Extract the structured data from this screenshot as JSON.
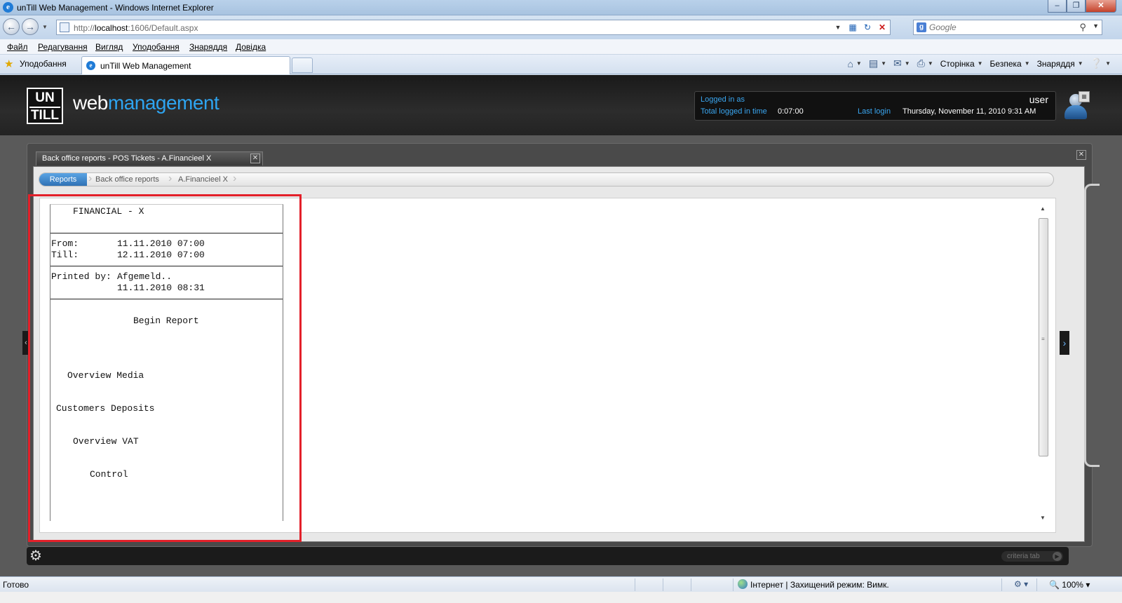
{
  "browser": {
    "window_title": "unTill Web Management - Windows Internet Explorer",
    "url_prefix": "http://",
    "url_host": "localhost",
    "url_rest": ":1606/Default.aspx",
    "search_placeholder": "Google",
    "menu": [
      "Файл",
      "Редагування",
      "Вигляд",
      "Уподобання",
      "Знаряддя",
      "Довідка"
    ],
    "favorites_label": "Уподобання",
    "tab_title": "unTill Web Management",
    "commands": {
      "page": "Сторінка",
      "safety": "Безпека",
      "tools": "Знаряддя"
    },
    "status": {
      "ready": "Готово",
      "zone": "Інтернет | Захищений режим: Вимк.",
      "zoom": "100%"
    }
  },
  "app": {
    "logo_line1": "UN",
    "logo_line2": "TILL",
    "brand_web": "web",
    "brand_management": "management",
    "user": {
      "logged_in_label": "Logged in as",
      "username": "user",
      "total_time_label": "Total logged in time",
      "total_time": "0:07:00",
      "last_login_label": "Last login",
      "last_login": "Thursday, November 11, 2010 9:31 AM"
    },
    "panel_tab": "Back office reports - POS Tickets - A.Financieel X",
    "breadcrumb": [
      "Reports",
      "Back office reports",
      "A.Financieel X"
    ],
    "criteria_tab": "criteria tab"
  },
  "report": {
    "title": "FINANCIAL - X",
    "from_label": "From:",
    "from_value": "11.11.2010 07:00",
    "till_label": "Till:",
    "till_value": "12.11.2010 07:00",
    "printed_by_label": "Printed by:",
    "printed_by_value": "Afgemeld..",
    "printed_at": "11.11.2010 08:31",
    "begin": "Begin Report",
    "sections": [
      "Overview Media",
      "Customers Deposits",
      "Overview VAT",
      "Control"
    ]
  },
  "colors": {
    "accent_blue": "#2ea4f0",
    "highlight_red": "#e3202a",
    "breadcrumb_active": "#2f72b5"
  }
}
